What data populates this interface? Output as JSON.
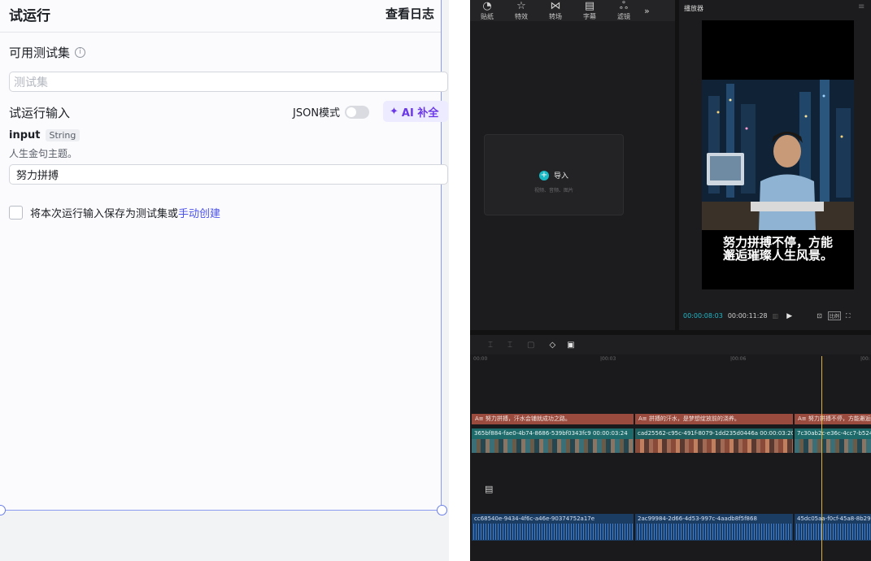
{
  "panel": {
    "title": "试运行",
    "view_logs": "查看日志",
    "testset_label": "可用测试集",
    "testset_placeholder": "测试集",
    "input_section_label": "试运行输入",
    "json_mode_label": "JSON模式",
    "ai_complete_label": "AI 补全",
    "param_name": "input",
    "param_type": "String",
    "param_desc": "人生金句主题。",
    "param_value": "努力拼搏",
    "save_text": "将本次运行输入保存为测试集或",
    "save_link": "手动创建"
  },
  "editor": {
    "toolbar": [
      {
        "label": "贴纸",
        "icon": "sticker-icon"
      },
      {
        "label": "特效",
        "icon": "effects-icon"
      },
      {
        "label": "转场",
        "icon": "transition-icon"
      },
      {
        "label": "字幕",
        "icon": "caption-icon"
      },
      {
        "label": "滤镜",
        "icon": "filter-icon"
      }
    ],
    "import_label": "导入",
    "import_sub": "视频、音频、图片",
    "player_title": "播放器",
    "video_caption_line1": "努力拼搏不停，方能",
    "video_caption_line2": "邂逅璀璨人生风景。",
    "time_current": "00:00:08:03",
    "time_total": "00:00:11:28",
    "ratio_label": "比例",
    "ruler": [
      "00:00",
      "|00:03",
      "|00:06",
      "|00:"
    ],
    "text_clips": [
      "A≡ 努力拼搏，汗水会铺就成功之路。",
      "A≡ 拼搏的汗水，是梦想绽放前的浇养。",
      "A≡ 努力拼搏不停，方能邂逅"
    ],
    "video_clips": [
      "365bf884-fae0-4b74-8686-539bf0343fc9  00:00:03:24",
      "cad25562-c95c-491f-8079-1dd235d0446a  00:00:03:20",
      "7c30ab2c-e36c-4cc7-b524"
    ],
    "audio_clips": [
      "cc68540e-9434-4f6c-a46e-90374752a17e",
      "2ac99984-2d66-4d53-997c-4aadb8f5f868",
      "45dc05aa-f0cf-45a8-8b29-"
    ]
  }
}
